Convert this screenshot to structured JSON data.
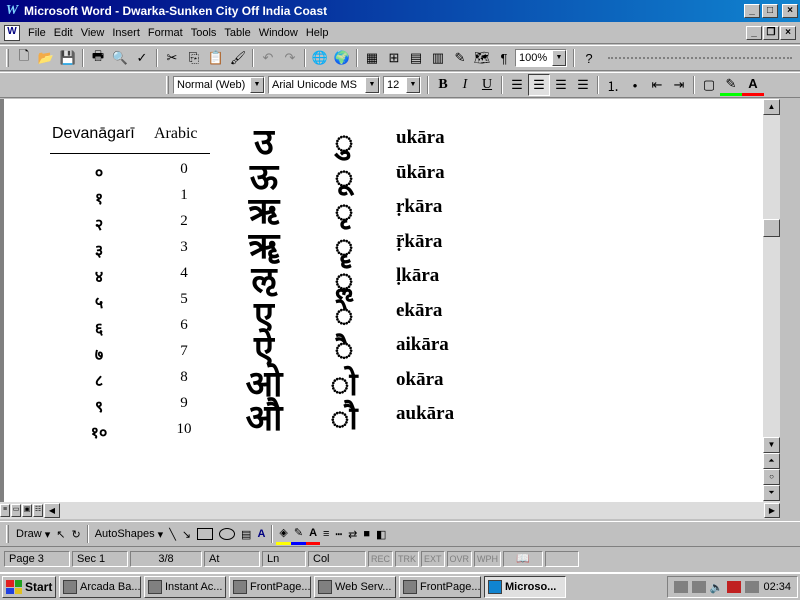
{
  "window": {
    "title": "Microsoft Word - Dwarka-Sunken City Off India Coast",
    "app_icon": "W"
  },
  "menu": [
    "File",
    "Edit",
    "View",
    "Insert",
    "Format",
    "Tools",
    "Table",
    "Window",
    "Help"
  ],
  "toolbar": {
    "zoom": "100%"
  },
  "formatting": {
    "style": "Normal (Web)",
    "font": "Arial Unicode MS",
    "size": "12",
    "bold": "B",
    "italic": "I",
    "underline": "U"
  },
  "document": {
    "headers": {
      "devanagari": "Devanāgarī",
      "arabic": "Arabic"
    },
    "numerals": [
      {
        "dev": "०",
        "ar": "0"
      },
      {
        "dev": "१",
        "ar": "1"
      },
      {
        "dev": "२",
        "ar": "2"
      },
      {
        "dev": "३",
        "ar": "3"
      },
      {
        "dev": "४",
        "ar": "4"
      },
      {
        "dev": "५",
        "ar": "5"
      },
      {
        "dev": "६",
        "ar": "6"
      },
      {
        "dev": "७",
        "ar": "7"
      },
      {
        "dev": "८",
        "ar": "8"
      },
      {
        "dev": "९",
        "ar": "9"
      },
      {
        "dev": "१०",
        "ar": "10"
      }
    ],
    "vowels": [
      {
        "letter": "उ",
        "sign": "ु",
        "name": "ukāra"
      },
      {
        "letter": "ऊ",
        "sign": "ू",
        "name": "ūkāra"
      },
      {
        "letter": "ऋ",
        "sign": "ृ",
        "name": "ṛkāra"
      },
      {
        "letter": "ॠ",
        "sign": "ॄ",
        "name": "ṝkāra"
      },
      {
        "letter": "ऌ",
        "sign": "ॢ",
        "name": "ḷkāra"
      },
      {
        "letter": "ए",
        "sign": "े",
        "name": "ekāra"
      },
      {
        "letter": "ऐ",
        "sign": "ै",
        "name": "aikāra"
      },
      {
        "letter": "ओ",
        "sign": "ो",
        "name": "okāra"
      },
      {
        "letter": "औ",
        "sign": "ौ",
        "name": "aukāra"
      }
    ]
  },
  "drawing": {
    "draw": "Draw",
    "autoshapes": "AutoShapes"
  },
  "status": {
    "page": "Page 3",
    "sec": "Sec 1",
    "pages": "3/8",
    "at": "At",
    "ln": "Ln",
    "col": "Col",
    "rec": "REC",
    "trk": "TRK",
    "ext": "EXT",
    "ovr": "OVR",
    "wph": "WPH"
  },
  "taskbar": {
    "start": "Start",
    "tasks": [
      "Arcada Ba...",
      "Instant Ac...",
      "FrontPage...",
      "Web Serv...",
      "FrontPage...",
      "Microso..."
    ],
    "clock": "02:34"
  },
  "colors": {
    "title_start": "#000080",
    "title_end": "#1084d0",
    "chrome": "#c0c0c0",
    "highlight": "#00ff00",
    "font_color": "#ff0000"
  }
}
